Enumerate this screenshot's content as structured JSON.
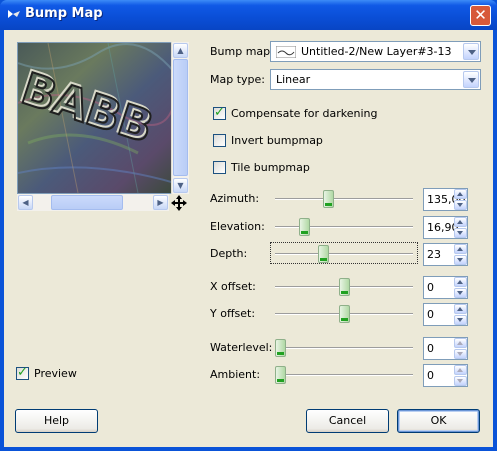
{
  "window": {
    "title": "Bump Map"
  },
  "preview_checkbox": {
    "label": "Preview",
    "checked": true
  },
  "bump_map": {
    "label": "Bump map:",
    "value": "Untitled-2/New Layer#3-13"
  },
  "map_type": {
    "label": "Map type:",
    "value": "Linear"
  },
  "options": {
    "compensate": {
      "label": "Compensate for darkening",
      "checked": true
    },
    "invert": {
      "label": "Invert bumpmap",
      "checked": false
    },
    "tile": {
      "label": "Tile bumpmap",
      "checked": false
    }
  },
  "sliders": {
    "azimuth": {
      "label": "Azimuth:",
      "value": "135,00",
      "fraction": 0.375
    },
    "elevation": {
      "label": "Elevation:",
      "value": "16,90",
      "fraction": 0.188
    },
    "depth": {
      "label": "Depth:",
      "value": "23",
      "fraction": 0.34
    },
    "x_offset": {
      "label": "X offset:",
      "value": "0",
      "fraction": 0.5
    },
    "y_offset": {
      "label": "Y offset:",
      "value": "0",
      "fraction": 0.5
    },
    "waterlevel": {
      "label": "Waterlevel:",
      "value": "0",
      "fraction": 0.0
    },
    "ambient": {
      "label": "Ambient:",
      "value": "0",
      "fraction": 0.0
    }
  },
  "buttons": {
    "help": "Help",
    "cancel": "Cancel",
    "ok": "OK"
  }
}
